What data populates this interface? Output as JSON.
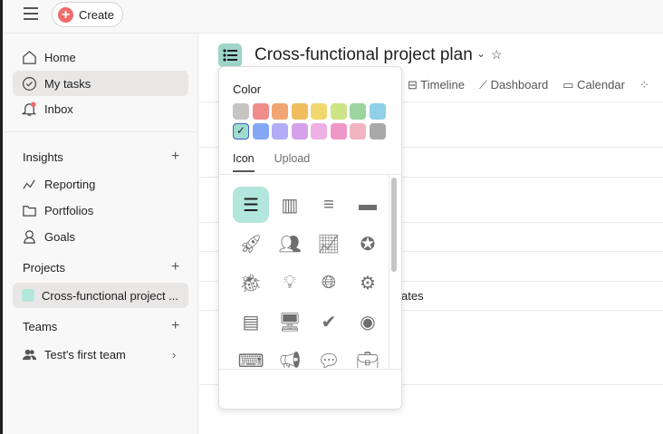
{
  "topbar": {
    "create_label": "Create"
  },
  "sidebar": {
    "nav": [
      {
        "label": "Home",
        "icon": "home-icon"
      },
      {
        "label": "My tasks",
        "icon": "check-circle-icon",
        "selected": true
      },
      {
        "label": "Inbox",
        "icon": "bell-icon"
      }
    ],
    "insights": {
      "title": "Insights",
      "items": [
        {
          "label": "Reporting"
        },
        {
          "label": "Portfolios"
        },
        {
          "label": "Goals"
        }
      ]
    },
    "projects": {
      "title": "Projects",
      "items": [
        {
          "label": "Cross-functional project ...",
          "color": "#b3e6dc"
        }
      ]
    },
    "teams": {
      "title": "Teams",
      "items": [
        {
          "label": "Test's first team"
        }
      ]
    }
  },
  "header": {
    "title": "Cross-functional project plan",
    "tabs": [
      "Timeline",
      "Dashboard",
      "Calendar"
    ]
  },
  "main": {
    "row_text": "ates"
  },
  "popover": {
    "color_title": "Color",
    "colors": [
      "#c7c4c4",
      "#f08c8c",
      "#f0a572",
      "#efbd5e",
      "#f1d86e",
      "#cde486",
      "#9cd4a1",
      "#8fcfe8",
      "#9fdccd",
      "#84a8f6",
      "#b5acf7",
      "#d7a1ea",
      "#eeb1e5",
      "#ef97c7",
      "#f2b4c1",
      "#a9a9a9"
    ],
    "selected_color": "#9fdccd",
    "tabs": [
      "Icon",
      "Upload"
    ],
    "active_tab": "Icon",
    "icons": [
      "list",
      "board",
      "timeline",
      "calendar",
      "rocket",
      "people",
      "chart-up",
      "star-circle",
      "bug",
      "lightbulb",
      "globe",
      "gear",
      "notebook",
      "desktop",
      "check-circle",
      "target",
      "code",
      "megaphone",
      "chat",
      "briefcase"
    ],
    "selected_icon": "list"
  }
}
